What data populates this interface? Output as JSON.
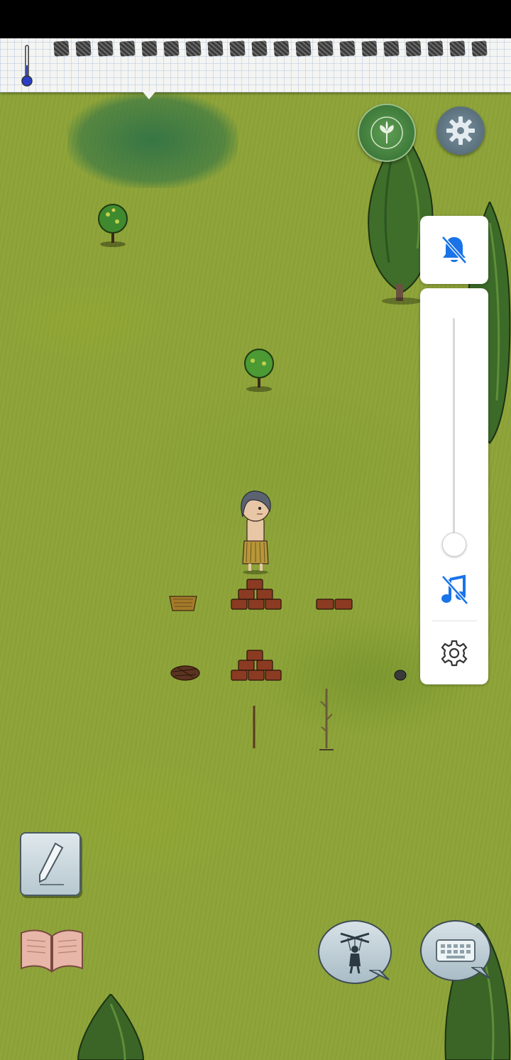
{
  "game": {
    "hud": {
      "thermometer_icon": "thermometer-icon",
      "food_pip_count": 20,
      "compass_icon": "sprout-compass-icon",
      "settings_icon": "gear-icon"
    },
    "volume_panel": {
      "ringer_icon": "bell-off-icon",
      "volume_level": 0.0,
      "music_icon": "music-off-icon",
      "settings_icon": "gear-outline-icon",
      "accent_color": "#1a73e8"
    },
    "bottom_controls": {
      "pencil_icon": "pencil-icon",
      "book_icon": "open-book-icon",
      "puppet_icon": "puppet-icon",
      "keyboard_icon": "keyboard-icon"
    },
    "colors": {
      "grass": "#8fa53a",
      "swamp": "#2f7a52",
      "paper": "#f4f5f2",
      "brick": "#8a3b22"
    }
  }
}
